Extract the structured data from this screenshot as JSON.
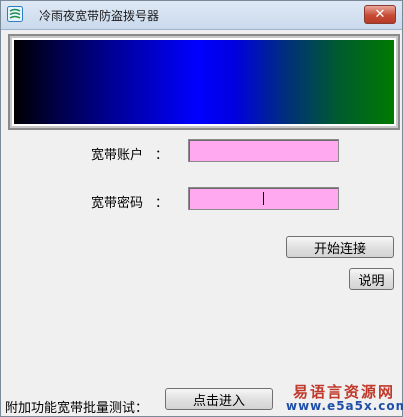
{
  "window": {
    "title": "冷雨夜宽带防盗拨号器",
    "close_glyph": "✕",
    "app_icon": "app-logo-icon"
  },
  "form": {
    "account_label": "宽带账户",
    "password_label": "宽带密码",
    "colon": "：",
    "account_value": "",
    "password_value": "",
    "field_color": "#ffaaf0"
  },
  "buttons": {
    "connect_label": "开始连接",
    "help_label": "说明",
    "enter_label": "点击进入"
  },
  "footer": {
    "batch_test_label": "附加功能宽带批量测试："
  },
  "brand": {
    "name": "易语言资源网",
    "url": "www.e5a5x.com"
  },
  "colors": {
    "gradient_start": "#000000",
    "gradient_mid": "#0000ff",
    "gradient_end": "#007a00"
  }
}
